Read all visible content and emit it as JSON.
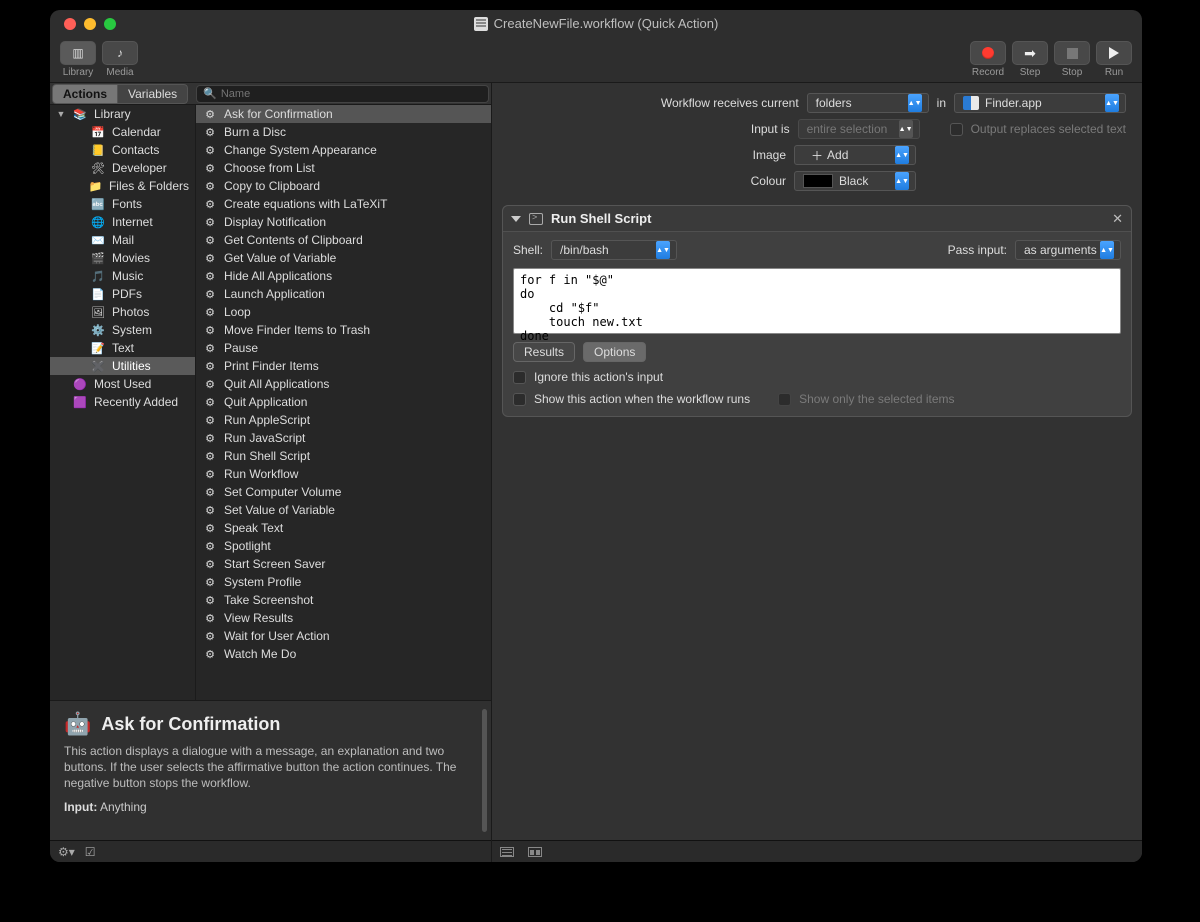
{
  "titlebar": {
    "title": "CreateNewFile.workflow (Quick Action)"
  },
  "toolbar": {
    "library": "Library",
    "media": "Media",
    "record": "Record",
    "step": "Step",
    "stop": "Stop",
    "run": "Run"
  },
  "leftTabs": {
    "actions": "Actions",
    "variables": "Variables"
  },
  "search": {
    "placeholder": "Name"
  },
  "categories": [
    {
      "name": "Library",
      "emoji": "📚",
      "expandable": true,
      "indent": 0
    },
    {
      "name": "Calendar",
      "emoji": "📅",
      "indent": 1
    },
    {
      "name": "Contacts",
      "emoji": "📒",
      "indent": 1
    },
    {
      "name": "Developer",
      "emoji": "🛠",
      "indent": 1
    },
    {
      "name": "Files & Folders",
      "emoji": "📁",
      "indent": 1
    },
    {
      "name": "Fonts",
      "emoji": "🔤",
      "indent": 1
    },
    {
      "name": "Internet",
      "emoji": "🌐",
      "indent": 1
    },
    {
      "name": "Mail",
      "emoji": "✉️",
      "indent": 1
    },
    {
      "name": "Movies",
      "emoji": "🎬",
      "indent": 1
    },
    {
      "name": "Music",
      "emoji": "🎵",
      "indent": 1
    },
    {
      "name": "PDFs",
      "emoji": "📄",
      "indent": 1
    },
    {
      "name": "Photos",
      "emoji": "🖼",
      "indent": 1
    },
    {
      "name": "System",
      "emoji": "⚙️",
      "indent": 1
    },
    {
      "name": "Text",
      "emoji": "📝",
      "indent": 1
    },
    {
      "name": "Utilities",
      "emoji": "✖️",
      "indent": 1,
      "selected": true
    },
    {
      "name": "Most Used",
      "emoji": "🟣",
      "indent": 0
    },
    {
      "name": "Recently Added",
      "emoji": "🟪",
      "indent": 0
    }
  ],
  "actions": [
    {
      "name": "Ask for Confirmation",
      "selected": true
    },
    {
      "name": "Burn a Disc"
    },
    {
      "name": "Change System Appearance"
    },
    {
      "name": "Choose from List"
    },
    {
      "name": "Copy to Clipboard"
    },
    {
      "name": "Create equations with LaTeXiT"
    },
    {
      "name": "Display Notification"
    },
    {
      "name": "Get Contents of Clipboard"
    },
    {
      "name": "Get Value of Variable"
    },
    {
      "name": "Hide All Applications"
    },
    {
      "name": "Launch Application"
    },
    {
      "name": "Loop"
    },
    {
      "name": "Move Finder Items to Trash"
    },
    {
      "name": "Pause"
    },
    {
      "name": "Print Finder Items"
    },
    {
      "name": "Quit All Applications"
    },
    {
      "name": "Quit Application"
    },
    {
      "name": "Run AppleScript"
    },
    {
      "name": "Run JavaScript"
    },
    {
      "name": "Run Shell Script"
    },
    {
      "name": "Run Workflow"
    },
    {
      "name": "Set Computer Volume"
    },
    {
      "name": "Set Value of Variable"
    },
    {
      "name": "Speak Text"
    },
    {
      "name": "Spotlight"
    },
    {
      "name": "Start Screen Saver"
    },
    {
      "name": "System Profile"
    },
    {
      "name": "Take Screenshot"
    },
    {
      "name": "View Results"
    },
    {
      "name": "Wait for User Action"
    },
    {
      "name": "Watch Me Do"
    }
  ],
  "description": {
    "title": "Ask for Confirmation",
    "body": "This action displays a dialogue with a message, an explanation and two buttons. If the user selects the affirmative button the action continues. The negative button stops the workflow.",
    "inputLabel": "Input:",
    "inputValue": "Anything"
  },
  "config": {
    "receivesLabel": "Workflow receives current",
    "receivesValue": "folders",
    "inLabel": "in",
    "inApp": "Finder.app",
    "inputIsLabel": "Input is",
    "inputIsValue": "entire selection",
    "outputReplaces": "Output replaces selected text",
    "imageLabel": "Image",
    "imageValue": "Add",
    "colourLabel": "Colour",
    "colourValue": "Black"
  },
  "shellAction": {
    "title": "Run Shell Script",
    "shellLabel": "Shell:",
    "shellValue": "/bin/bash",
    "passLabel": "Pass input:",
    "passValue": "as arguments",
    "script": "for f in \"$@\"\ndo\n    cd \"$f\"\n    touch new.txt\ndone",
    "results": "Results",
    "options": "Options",
    "ignore": "Ignore this action's input",
    "showWhenRuns": "Show this action when the workflow runs",
    "showOnlySel": "Show only the selected items"
  }
}
